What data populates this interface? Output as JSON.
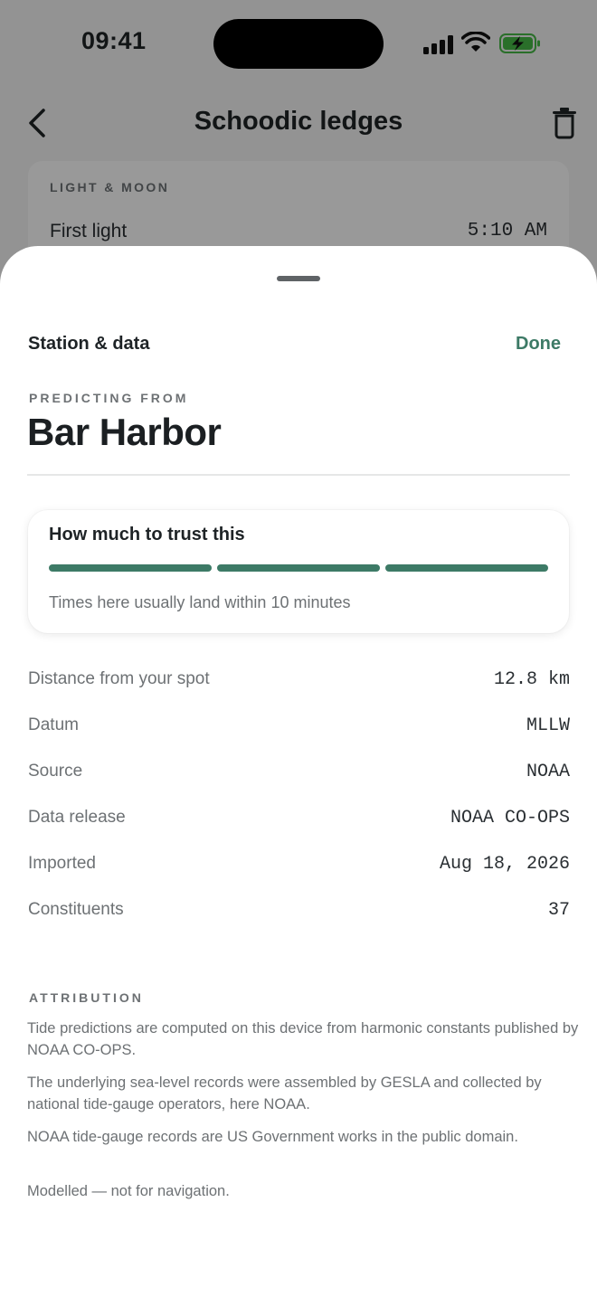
{
  "status_bar": {
    "time": "09:41"
  },
  "background": {
    "title": "Schoodic ledges",
    "card_title": "LIGHT & MOON",
    "row_label": "First light",
    "row_value": "5:10 AM"
  },
  "sheet": {
    "title": "Station & data",
    "done_label": "Done",
    "eyebrow": "PREDICTING FROM",
    "station_name": "Bar Harbor",
    "trust": {
      "title": "How much to trust this",
      "level_filled": 3,
      "level_total": 3,
      "note": "Times here usually land within 10 minutes",
      "color": "#3d7a66"
    },
    "details": [
      {
        "label": "Distance from your spot",
        "value": "12.8 km"
      },
      {
        "label": "Datum",
        "value": "MLLW"
      },
      {
        "label": "Source",
        "value": "NOAA"
      },
      {
        "label": "Data release",
        "value": "NOAA CO-OPS"
      },
      {
        "label": "Imported",
        "value": "Aug 18, 2026"
      },
      {
        "label": "Constituents",
        "value": "37"
      }
    ],
    "attribution": {
      "heading": "ATTRIBUTION",
      "paragraphs": [
        "Tide predictions are computed on this device from harmonic constants published by NOAA CO-OPS.",
        "The underlying sea-level records were assembled by GESLA and collected by national tide-gauge operators, here NOAA.",
        "NOAA tide-gauge records are US Government works in the public domain.",
        "Modelled — not for navigation."
      ]
    }
  },
  "icons": {
    "back": "chevron-left-icon",
    "delete": "trash-icon",
    "signal": "cellular-signal-icon",
    "wifi": "wifi-icon",
    "battery": "battery-charging-icon"
  }
}
